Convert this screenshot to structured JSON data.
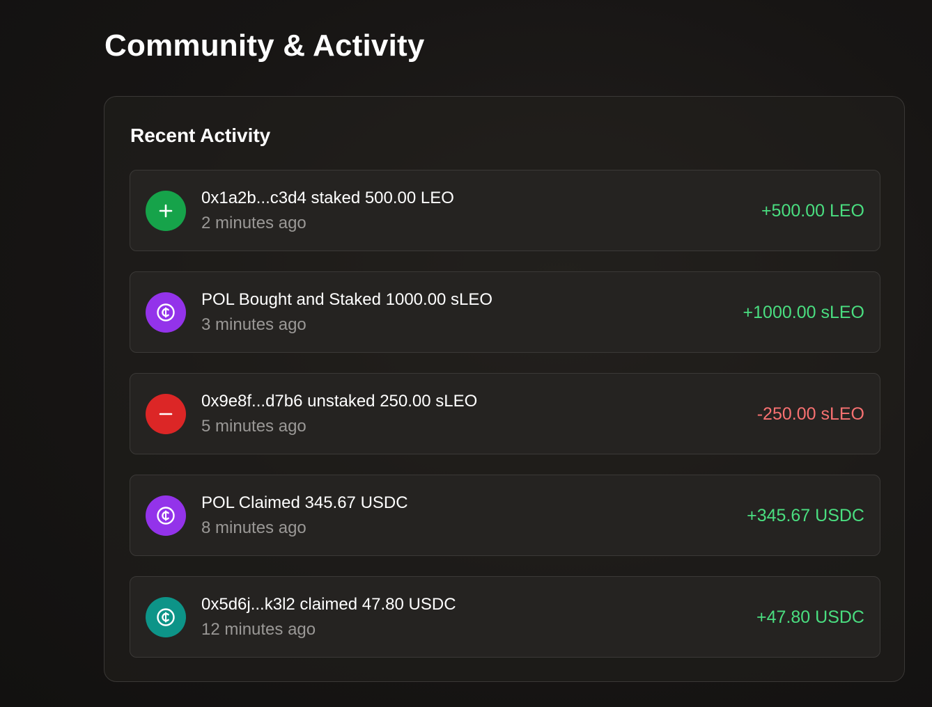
{
  "page": {
    "title": "Community & Activity"
  },
  "activity": {
    "title": "Recent Activity",
    "items": [
      {
        "icon": "plus-icon",
        "icon_color": "#16a34a",
        "description": "0x1a2b...c3d4 staked 500.00 LEO",
        "time": "2 minutes ago",
        "amount": "+500.00 LEO",
        "amount_color": "#4ade80"
      },
      {
        "icon": "usdc-coin-icon",
        "icon_color": "#9333ea",
        "description": "POL Bought and Staked 1000.00 sLEO",
        "time": "3 minutes ago",
        "amount": "+1000.00 sLEO",
        "amount_color": "#4ade80"
      },
      {
        "icon": "minus-icon",
        "icon_color": "#dc2626",
        "description": "0x9e8f...d7b6 unstaked 250.00 sLEO",
        "time": "5 minutes ago",
        "amount": "-250.00 sLEO",
        "amount_color": "#f87171"
      },
      {
        "icon": "usdc-coin-icon",
        "icon_color": "#9333ea",
        "description": "POL Claimed 345.67 USDC",
        "time": "8 minutes ago",
        "amount": "+345.67 USDC",
        "amount_color": "#4ade80"
      },
      {
        "icon": "usdc-coin-icon",
        "icon_color": "#0d9488",
        "description": "0x5d6j...k3l2 claimed 47.80 USDC",
        "time": "12 minutes ago",
        "amount": "+47.80 USDC",
        "amount_color": "#4ade80"
      }
    ]
  }
}
